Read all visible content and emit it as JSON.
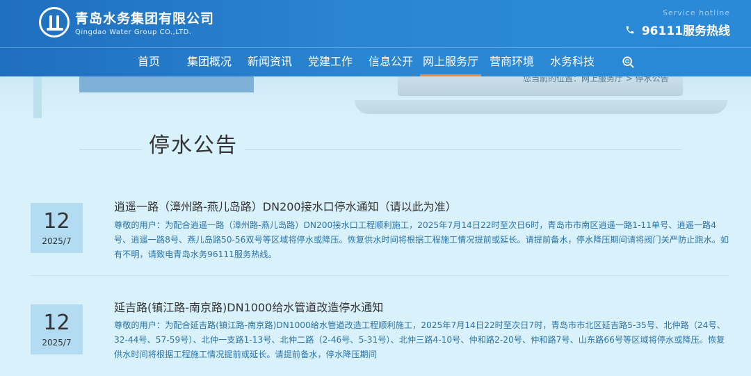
{
  "header": {
    "logo_cn": "青岛水务集团有限公司",
    "logo_en": "Qingdao Water Group CO.,LTD.",
    "hotline_label": "Service hotline",
    "hotline_text": "96111服务热线"
  },
  "nav": {
    "items": [
      {
        "label": "首页"
      },
      {
        "label": "集团概况"
      },
      {
        "label": "新闻资讯"
      },
      {
        "label": "党建工作"
      },
      {
        "label": "信息公开"
      },
      {
        "label": "网上服务厅"
      },
      {
        "label": "营商环境"
      },
      {
        "label": "水务科技"
      }
    ],
    "active": "网上服务厅"
  },
  "breadcrumb": "您当前的位置：网上服务厅 > 停水公告",
  "section_title": "停水公告",
  "notices": [
    {
      "day": "12",
      "year_month": "2025/7",
      "title": "逍遥一路（漳州路-燕儿岛路）DN200接水口停水通知（请以此为准）",
      "body": "尊敬的用户：为配合逍遥一路（漳州路-燕儿岛路）DN200接水口工程顺利施工，2025年7月14日22时至次日6时，青岛市市南区逍遥一路1-11单号、逍遥一路4号、逍遥一路8号、燕儿岛路50-56双号等区域将停水或降压。恢复供水时间将根据工程施工情况提前或延长。请提前备水，停水降压期间请将阀门关严防止跑水。如有不明，请致电青岛水务96111服务热线。"
    },
    {
      "day": "12",
      "year_month": "2025/7",
      "title": "延吉路(镇江路-南京路)DN1000给水管道改造停水通知",
      "body": "尊敬的用户：为配合延吉路(镇江路-南京路)DN1000给水管道改造工程顺利施工，2025年7月14日22时至次日7时，青岛市市北区延吉路5-35号、北仲路（24号、32-44号、57-59号）、北仲一支路1-13号、北仲二路（2-46号、5-31号）、北仲三路4-10号、仲和路2-20号、仲和路7号、山东路66号等区域将停水或降压。恢复供水时间将根据工程施工情况提前或延长。请提前备水，停水降压期间"
    }
  ]
}
